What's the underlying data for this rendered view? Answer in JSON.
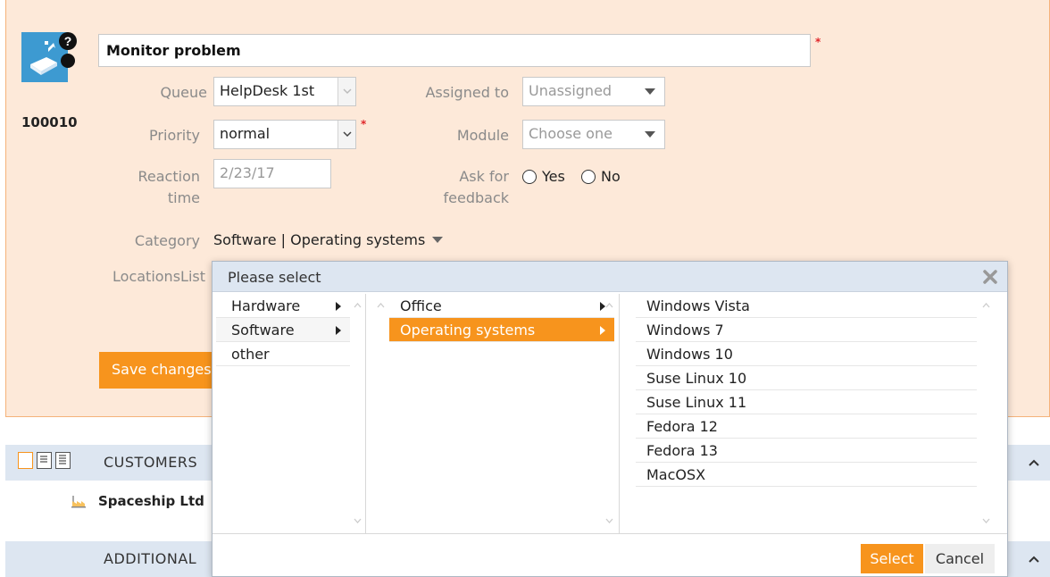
{
  "ticket": {
    "id": "100010",
    "title": "Monitor problem",
    "required_mark": "*",
    "queue_label": "Queue",
    "queue_value": "HelpDesk 1st",
    "priority_label": "Priority",
    "priority_value": "normal",
    "reaction_label_1": "Reaction",
    "reaction_label_2": "time",
    "reaction_placeholder": "2/23/17",
    "assigned_label": "Assigned to",
    "assigned_value": "Unassigned",
    "module_label": "Module",
    "module_value": "Choose one",
    "feedback_label_1": "Ask for",
    "feedback_label_2": "feedback",
    "feedback_yes": "Yes",
    "feedback_no": "No",
    "category_label": "Category",
    "category_value": "Software | Operating systems",
    "locations_label": "LocationsList",
    "save_label": "Save changes"
  },
  "sections": {
    "customers_title": "CUSTOMERS",
    "customer_name": "Spaceship Ltd",
    "additional_title": "ADDITIONAL"
  },
  "dialog": {
    "title": "Please select",
    "col1": [
      "Hardware",
      "Software",
      "other"
    ],
    "col2": [
      "Office",
      "Operating systems"
    ],
    "col3": [
      "Windows Vista",
      "Windows 7",
      "Windows 10",
      "Suse Linux 10",
      "Suse Linux 11",
      "Fedora 12",
      "Fedora 13",
      "MacOSX"
    ],
    "select_label": "Select",
    "cancel_label": "Cancel"
  },
  "colors": {
    "accent": "#f7941d",
    "panel_bg": "#fde9d9",
    "section_bg": "#dde6f1",
    "required": "#e0262a"
  }
}
